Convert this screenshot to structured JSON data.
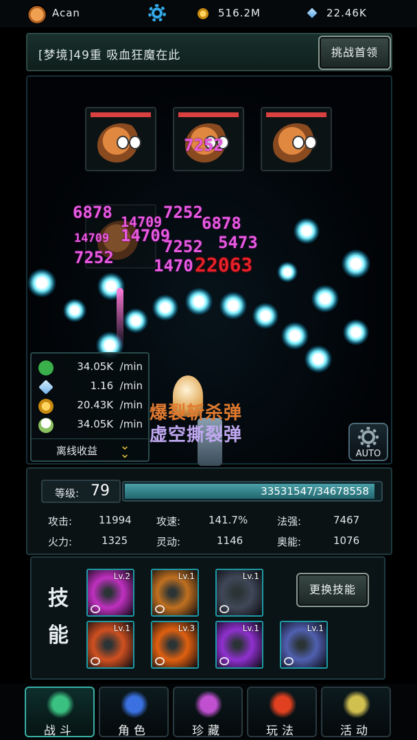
{
  "top": {
    "username": "Acan",
    "gold": "516.2M",
    "gems": "22.46K"
  },
  "stage": {
    "title": "[梦境]49重 吸血狂魔在此",
    "challenge_button": "挑战首领"
  },
  "battle": {
    "damage_numbers": [
      {
        "text": "7252",
        "red": false
      },
      {
        "text": "6878",
        "red": false
      },
      {
        "text": "14709",
        "red": false
      },
      {
        "text": "7252",
        "red": false
      },
      {
        "text": "6878",
        "red": false
      },
      {
        "text": "14709",
        "red": false
      },
      {
        "text": "7252",
        "red": false
      },
      {
        "text": "5473",
        "red": false
      },
      {
        "text": "14709",
        "red": false
      },
      {
        "text": "7252",
        "red": false
      },
      {
        "text": "1470",
        "red": false
      },
      {
        "text": "22063",
        "red": true
      }
    ],
    "skill_labels": [
      "爆裂斩杀弹",
      "虚空撕裂弹"
    ]
  },
  "income": {
    "rows": [
      {
        "icon": "exp-icon",
        "value": "34.05K  /min"
      },
      {
        "icon": "gem-icon",
        "value": "1.16  /min"
      },
      {
        "icon": "gold-icon",
        "value": "20.43K  /min"
      },
      {
        "icon": "rice-icon",
        "value": "34.05K  /min"
      }
    ],
    "offline_label": "离线收益"
  },
  "auto_label": "AUTO",
  "stats": {
    "level_label": "等级:",
    "level": "79",
    "exp": "33531547/34678558",
    "exp_progress": 0.967,
    "items": [
      {
        "label": "攻击:",
        "value": "11994"
      },
      {
        "label": "攻速:",
        "value": "141.7%"
      },
      {
        "label": "法强:",
        "value": "7467"
      },
      {
        "label": "火力:",
        "value": "1325"
      },
      {
        "label": "灵动:",
        "value": "1146"
      },
      {
        "label": "奥能:",
        "value": "1076"
      }
    ]
  },
  "skills": {
    "title_1": "技",
    "title_2": "能",
    "change_button": "更换技能",
    "slots": [
      {
        "level": "Lv.2",
        "color": "#c030c0"
      },
      {
        "level": "Lv.1",
        "color": "#c07020"
      },
      {
        "level": "Lv.1",
        "color": "#404858"
      },
      {
        "level": "Lv.1",
        "color": "#d05020"
      },
      {
        "level": "Lv.3",
        "color": "#e06010"
      },
      {
        "level": "Lv.1",
        "color": "#9030d0"
      },
      {
        "level": "Lv.1",
        "color": "#5060b0"
      }
    ]
  },
  "nav": [
    {
      "label": "战斗",
      "icon": "crossed-swords-icon",
      "color": "#3ac080"
    },
    {
      "label": "角色",
      "icon": "character-icon",
      "color": "#3a70e0"
    },
    {
      "label": "珍藏",
      "icon": "treasure-icon",
      "color": "#c050d0"
    },
    {
      "label": "玩法",
      "icon": "play-mode-icon",
      "color": "#e04020"
    },
    {
      "label": "活动",
      "icon": "event-icon",
      "color": "#d0c050"
    }
  ]
}
